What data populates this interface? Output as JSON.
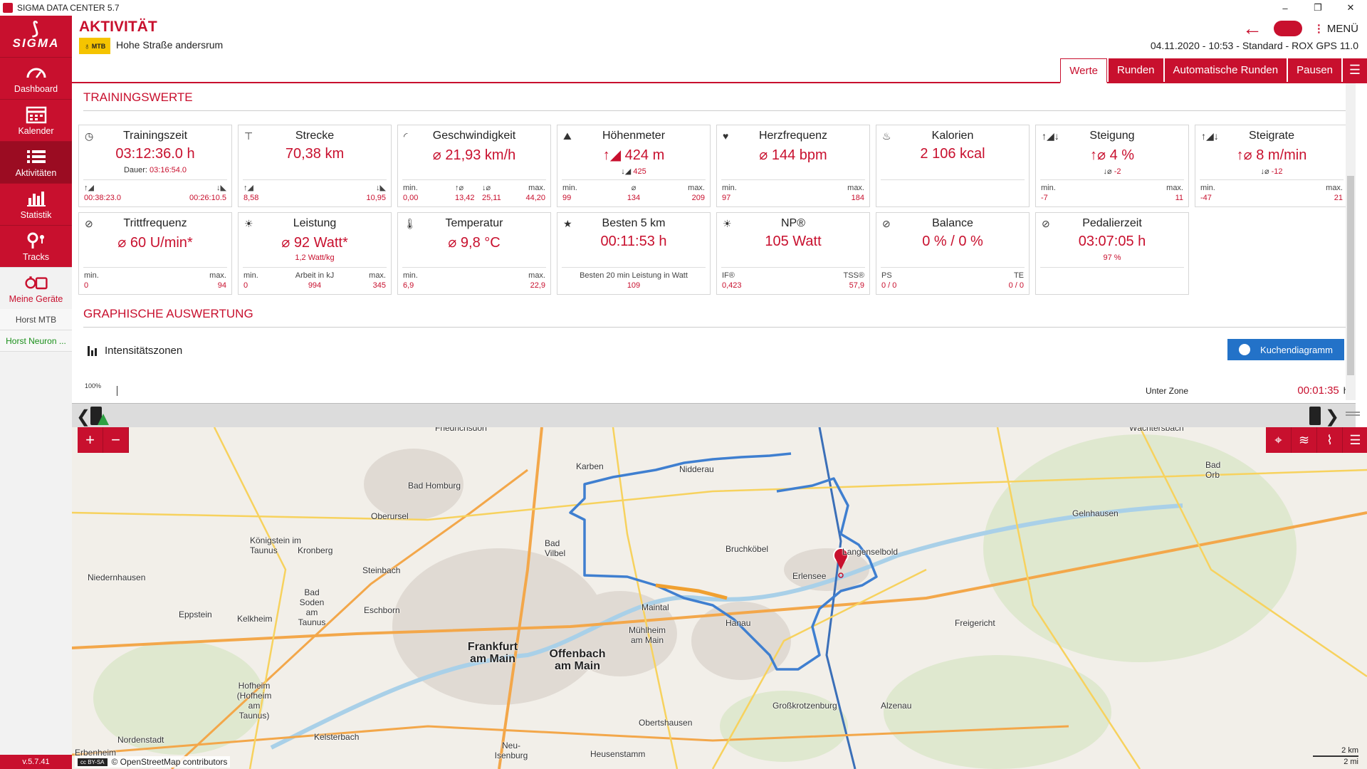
{
  "window": {
    "title": "SIGMA DATA CENTER 5.7"
  },
  "sidebar": {
    "logo": "SIGMA",
    "items": [
      {
        "label": "Dashboard",
        "icon": "dashboard-icon"
      },
      {
        "label": "Kalender",
        "icon": "calendar-icon"
      },
      {
        "label": "Aktivitäten",
        "icon": "list-icon"
      },
      {
        "label": "Statistik",
        "icon": "bar-chart-icon"
      },
      {
        "label": "Tracks",
        "icon": "tracks-icon"
      },
      {
        "label": "Meine Geräte",
        "icon": "devices-icon"
      }
    ],
    "devices": [
      "Horst MTB",
      "Horst Neuron ..."
    ],
    "version": "v.5.7.41"
  },
  "header": {
    "title": "AKTIVITÄT",
    "sport_badge": "MTB",
    "activity_name": "Hohe Straße andersrum",
    "menu_label": "MENÜ",
    "date": "04.11.2020",
    "time": "10:53",
    "profile": "Standard",
    "device": "ROX GPS 11.0"
  },
  "tabs": [
    "Werte",
    "Runden",
    "Automatische Runden",
    "Pausen"
  ],
  "sections": {
    "training": "TRAININGSWERTE",
    "graphic": "GRAPHISCHE AUSWERTUNG"
  },
  "cards": {
    "trainingszeit": {
      "name": "Trainingszeit",
      "value": "03:12:36.0 h",
      "sub_label": "Dauer:",
      "sub": "03:16:54.0",
      "left": "00:38:23.0",
      "right": "00:26:10.5"
    },
    "strecke": {
      "name": "Strecke",
      "value": "70,38 km",
      "left": "8,58",
      "right": "10,95"
    },
    "geschwindigkeit": {
      "name": "Geschwindigkeit",
      "value": "21,93 km/h",
      "min_label": "min.",
      "max_label": "max.",
      "min": "0,00",
      "up": "13,42",
      "down": "25,11",
      "max": "44,20"
    },
    "hoehenmeter": {
      "name": "Höhenmeter",
      "value": "424 m",
      "down_value": "425",
      "min_label": "min.",
      "max_label": "max.",
      "min": "99",
      "avg": "134",
      "max": "209"
    },
    "herzfrequenz": {
      "name": "Herzfrequenz",
      "value": "144 bpm",
      "min_label": "min.",
      "max_label": "max.",
      "min": "97",
      "max": "184"
    },
    "kalorien": {
      "name": "Kalorien",
      "value": "2 106 kcal"
    },
    "steigung": {
      "name": "Steigung",
      "value": "4 %",
      "down_value": "-2",
      "min_label": "min.",
      "max_label": "max.",
      "min": "-7",
      "max": "11"
    },
    "steigrate": {
      "name": "Steigrate",
      "value": "8 m/min",
      "down_value": "-12",
      "min_label": "min.",
      "max_label": "max.",
      "min": "-47",
      "max": "21"
    },
    "trittfrequenz": {
      "name": "Trittfrequenz",
      "value": "60 U/min*",
      "min_label": "min.",
      "max_label": "max.",
      "min": "0",
      "max": "94"
    },
    "leistung": {
      "name": "Leistung",
      "value": "92 Watt*",
      "sub": "1,2 Watt/kg",
      "min_label": "min.",
      "mid_label": "Arbeit in kJ",
      "max_label": "max.",
      "min": "0",
      "mid": "994",
      "max": "345"
    },
    "temperatur": {
      "name": "Temperatur",
      "value": "9,8 °C",
      "min_label": "min.",
      "max_label": "max.",
      "min": "6,9",
      "max": "22,9"
    },
    "besten5": {
      "name": "Besten 5 km",
      "value": "00:11:53 h",
      "foot_label": "Besten 20 min Leistung in Watt",
      "foot_value": "109"
    },
    "np": {
      "name": "NP®",
      "value": "105 Watt",
      "left_label": "IF®",
      "right_label": "TSS®",
      "left": "0,423",
      "right": "57,9"
    },
    "balance": {
      "name": "Balance",
      "value": "0 %  /  0 %",
      "left_label": "PS",
      "right_label": "TE",
      "left": "0  /  0",
      "right": "0  /  0"
    },
    "pedalierzeit": {
      "name": "Pedalierzeit",
      "value": "03:07:05 h",
      "sub": "97 %"
    }
  },
  "graphic": {
    "zones_label": "Intensitätszonen",
    "pie_button": "Kuchendiagramm",
    "percent_label": "100%",
    "zone_name": "Unter Zone",
    "zone_time": "00:01:35",
    "zone_unit": "h"
  },
  "map": {
    "attribution": "© OpenStreetMap contributors",
    "license": "cc BY-SA",
    "scale_km": "2 km",
    "scale_mi": "2 mi",
    "towns": [
      {
        "name": "Friedrichsdorf",
        "big": false
      },
      {
        "name": "Karben",
        "big": false
      },
      {
        "name": "Nidderau",
        "big": false
      },
      {
        "name": "Wächtersbach",
        "big": false
      },
      {
        "name": "Bad Homburg",
        "big": false
      },
      {
        "name": "Oberursel",
        "big": false
      },
      {
        "name": "Königstein im Taunus",
        "big": false
      },
      {
        "name": "Kronberg",
        "big": false
      },
      {
        "name": "Bad Vilbel",
        "big": false
      },
      {
        "name": "Bruchköbel",
        "big": false
      },
      {
        "name": "Langenselbold",
        "big": false
      },
      {
        "name": "Gelnhausen",
        "big": false
      },
      {
        "name": "Bad Orb",
        "big": false
      },
      {
        "name": "Niedernhausen",
        "big": false
      },
      {
        "name": "Steinbach",
        "big": false
      },
      {
        "name": "Erlensee",
        "big": false
      },
      {
        "name": "Bad Soden am Taunus",
        "big": false
      },
      {
        "name": "Eschborn",
        "big": false
      },
      {
        "name": "Eppstein",
        "big": false
      },
      {
        "name": "Kelkheim",
        "big": false
      },
      {
        "name": "Maintal",
        "big": false
      },
      {
        "name": "Hanau",
        "big": false
      },
      {
        "name": "Freigericht",
        "big": false
      },
      {
        "name": "Frankfurt am Main",
        "big": true
      },
      {
        "name": "Offenbach am Main",
        "big": true
      },
      {
        "name": "Mühlheim am Main",
        "big": false
      },
      {
        "name": "Hofheim (Hofheim am Taunus)",
        "big": false
      },
      {
        "name": "Großkrotzenburg",
        "big": false
      },
      {
        "name": "Alzenau",
        "big": false
      },
      {
        "name": "Nordenstadt",
        "big": false
      },
      {
        "name": "Kelsterbach",
        "big": false
      },
      {
        "name": "Obertshausen",
        "big": false
      },
      {
        "name": "Neu-Isenburg",
        "big": false
      },
      {
        "name": "Heusenstamm",
        "big": false
      },
      {
        "name": "Erbenheim",
        "big": false
      }
    ]
  },
  "colors": {
    "brand": "#c8102e",
    "accent_blue": "#2372c8",
    "route": "#3f7fd0"
  }
}
